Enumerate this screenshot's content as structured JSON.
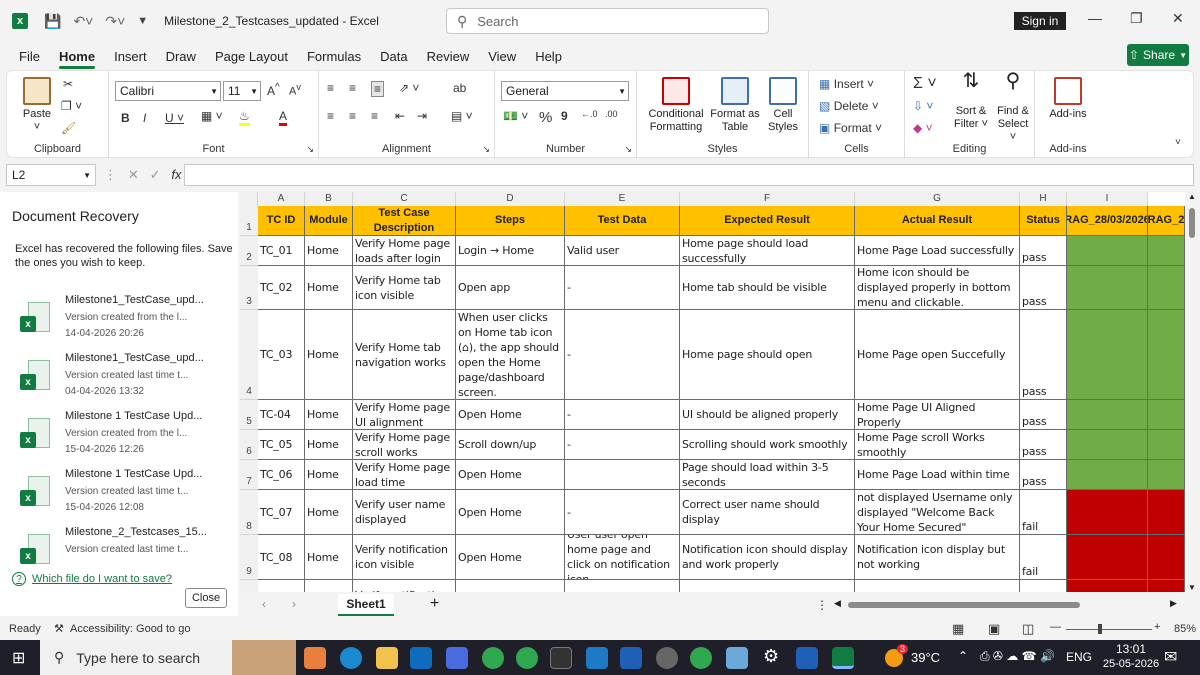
{
  "title_bar": {
    "doc_title": "Milestone_2_Testcases_updated  -  Excel",
    "search_placeholder": "Search",
    "sign_in": "Sign in"
  },
  "tabs": [
    "File",
    "Home",
    "Insert",
    "Draw",
    "Page Layout",
    "Formulas",
    "Data",
    "Review",
    "View",
    "Help"
  ],
  "share": "Share",
  "ribbon": {
    "clipboard": {
      "label": "Clipboard",
      "paste": "Paste"
    },
    "font": {
      "label": "Font",
      "name": "Calibri",
      "size": "11"
    },
    "alignment": {
      "label": "Alignment"
    },
    "number": {
      "label": "Number",
      "format": "General"
    },
    "styles": {
      "label": "Styles",
      "conditional": "Conditional Formatting",
      "format_table": "Format as Table",
      "cell_styles": "Cell Styles"
    },
    "cells": {
      "label": "Cells",
      "insert": "Insert",
      "delete": "Delete",
      "format": "Format"
    },
    "editing": {
      "label": "Editing",
      "sort": "Sort & Filter",
      "find": "Find & Select"
    },
    "addins": {
      "label": "Add-ins",
      "btn": "Add-ins"
    }
  },
  "formula_bar": {
    "name_box": "L2",
    "fx": "fx"
  },
  "recovery": {
    "title": "Document Recovery",
    "desc": "Excel has recovered the following files.  Save the ones you wish to keep.",
    "items": [
      {
        "name": "Milestone1_TestCase_upd...",
        "line": "Version created from the l...",
        "date": "14-04-2026 20:26"
      },
      {
        "name": "Milestone1_TestCase_upd...",
        "line": "Version created last time t...",
        "date": "04-04-2026 13:32"
      },
      {
        "name": "Milestone 1 TestCase Upd...",
        "line": "Version created from the l...",
        "date": "15-04-2026 12:26"
      },
      {
        "name": "Milestone 1 TestCase Upd...",
        "line": "Version created last time t...",
        "date": "15-04-2026 12:08"
      },
      {
        "name": "Milestone_2_Testcases_15...",
        "line": "Version created last time t...",
        "date": ""
      }
    ],
    "link": "Which file do I want to save?",
    "close": "Close"
  },
  "columns": [
    "A",
    "B",
    "C",
    "D",
    "E",
    "F",
    "G",
    "H",
    "I"
  ],
  "headers": [
    "TC ID",
    "Module",
    "Test Case Description",
    "Steps",
    "Test Data",
    "Expected Result",
    "Actual Result",
    "Status",
    "RAG_28/03/2026",
    "RAG_2"
  ],
  "rows": [
    {
      "n": "2",
      "id": "TC_01",
      "module": "Home",
      "desc": "Verify Home page loads after login",
      "steps": "Login → Home",
      "data": "Valid user",
      "expected": "Home page should load successfully",
      "actual": "Home Page Load successfully",
      "status": "pass"
    },
    {
      "n": "3",
      "id": "TC_02",
      "module": "Home",
      "desc": "Verify Home tab icon visible",
      "steps": "Open app",
      "data": "-",
      "expected": "Home tab should be visible",
      "actual": "Home icon should be displayed properly in bottom menu and clickable.",
      "status": "pass"
    },
    {
      "n": "4",
      "id": "TC_03",
      "module": "Home",
      "desc": "Verify Home tab navigation works",
      "steps": "When user clicks on Home tab icon (⌂), the app should open the Home page/dashboard screen.",
      "data": "-",
      "expected": "Home page should open",
      "actual": "Home Page open Succefully",
      "status": "pass"
    },
    {
      "n": "5",
      "id": "TC-04",
      "module": "Home",
      "desc": "Verify Home page UI alignment",
      "steps": "Open Home",
      "data": "-",
      "expected": "UI should be aligned properly",
      "actual": "Home Page UI  Aligned Properly",
      "status": "pass"
    },
    {
      "n": "6",
      "id": "TC_05",
      "module": "Home",
      "desc": "Verify Home page scroll works",
      "steps": "Scroll down/up",
      "data": "-",
      "expected": "Scrolling should work smoothly",
      "actual": "Home Page  scroll Works smoothly",
      "status": "pass"
    },
    {
      "n": "7",
      "id": "TC_06",
      "module": "Home",
      "desc": "Verify Home page load time",
      "steps": "Open Home",
      "data": "",
      "expected": "Page should load within 3-5 seconds",
      "actual": "Home Page Load within time",
      "status": "pass"
    },
    {
      "n": "8",
      "id": "TC_07",
      "module": "Home",
      "desc": "Verify user name displayed",
      "steps": "Open Home",
      "data": "-",
      "expected": "Correct user name should display",
      "actual": "not displayed Username only displayed \"Welcome Back Your Home Secured\"",
      "status": "fail"
    },
    {
      "n": "9",
      "id": "TC_08",
      "module": "Home",
      "desc": "Verify notification icon visible",
      "steps": "Open Home",
      "data": "User user open home page and click on notification icon",
      "expected": "Notification icon should display and work properly",
      "actual": "Notification icon display but not working",
      "status": "fail"
    },
    {
      "n": "",
      "id": "",
      "module": "",
      "desc": "Verify notification",
      "steps": "",
      "data": "",
      "expected": "",
      "actual": "",
      "status": ""
    }
  ],
  "rag": [
    "green",
    "green",
    "green",
    "green",
    "green",
    "green",
    "red",
    "red",
    "red"
  ],
  "sheet": {
    "name": "Sheet1"
  },
  "status_bar": {
    "ready": "Ready",
    "accessibility": "Accessibility: Good to go",
    "zoom": "85%"
  },
  "taskbar": {
    "search": "Type here to search",
    "weather": "39°C",
    "lang": "ENG",
    "time": "13:01",
    "date": "25-05-2026",
    "notif": "3"
  },
  "colors": {
    "accent": "#107c41",
    "header": "#ffc000",
    "pass": "#70ad47",
    "fail": "#c00000"
  }
}
